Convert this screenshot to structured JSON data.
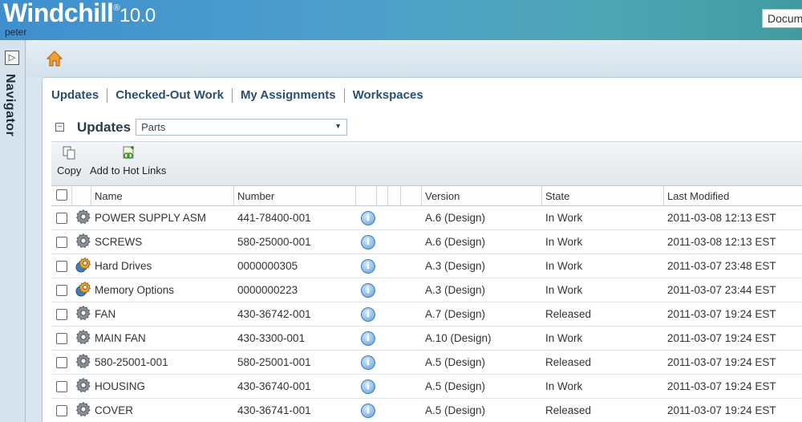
{
  "app": {
    "brand": "Windchill",
    "reg": "®",
    "version": "10.0",
    "user": "peter",
    "search_placeholder": "Docum"
  },
  "navigator": {
    "label": "Navigator",
    "toggle_icon": "expand-panel-icon"
  },
  "tabs": [
    "Updates",
    "Checked-Out Work",
    "My Assignments",
    "Workspaces"
  ],
  "section": {
    "title": "Updates",
    "view_value": "Parts",
    "collapse_symbol": "−",
    "dropdown_arrow": "▼"
  },
  "toolbar": {
    "copy_label": "Copy",
    "hotlinks_label": "Add to Hot Links"
  },
  "table": {
    "headers": {
      "name": "Name",
      "number": "Number",
      "version": "Version",
      "state": "State",
      "modified": "Last Modified"
    },
    "info_glyph": "i",
    "rows": [
      {
        "icon": "part-gear-icon",
        "name": "POWER SUPPLY ASM",
        "number": "441-78400-001",
        "version": "A.6 (Design)",
        "state": "In Work",
        "modified": "2011-03-08 12:13 EST"
      },
      {
        "icon": "part-gear-icon",
        "name": "SCREWS",
        "number": "580-25000-001",
        "version": "A.6 (Design)",
        "state": "In Work",
        "modified": "2011-03-08 12:13 EST"
      },
      {
        "icon": "configurable-part-icon",
        "name": "Hard Drives",
        "number": "0000000305",
        "version": "A.3 (Design)",
        "state": "In Work",
        "modified": "2011-03-07 23:48 EST"
      },
      {
        "icon": "configurable-part-icon",
        "name": "Memory Options",
        "number": "0000000223",
        "version": "A.3 (Design)",
        "state": "In Work",
        "modified": "2011-03-07 23:44 EST"
      },
      {
        "icon": "part-gear-icon",
        "name": "FAN",
        "number": "430-36742-001",
        "version": "A.7 (Design)",
        "state": "Released",
        "modified": "2011-03-07 19:24 EST"
      },
      {
        "icon": "part-gear-icon",
        "name": "MAIN FAN",
        "number": "430-3300-001",
        "version": "A.10 (Design)",
        "state": "In Work",
        "modified": "2011-03-07 19:24 EST"
      },
      {
        "icon": "part-gear-icon",
        "name": "580-25001-001",
        "number": "580-25001-001",
        "version": "A.5 (Design)",
        "state": "Released",
        "modified": "2011-03-07 19:24 EST"
      },
      {
        "icon": "part-gear-icon",
        "name": "HOUSING",
        "number": "430-36740-001",
        "version": "A.5 (Design)",
        "state": "In Work",
        "modified": "2011-03-07 19:24 EST"
      },
      {
        "icon": "part-gear-icon",
        "name": "COVER",
        "number": "430-36741-001",
        "version": "A.5 (Design)",
        "state": "Released",
        "modified": "2011-03-07 19:24 EST"
      }
    ]
  },
  "colors": {
    "header_start": "#3e8fcd",
    "header_end": "#3f9ba0",
    "tab_text": "#2b4e6f",
    "info_blue": "#5f9fd8"
  }
}
